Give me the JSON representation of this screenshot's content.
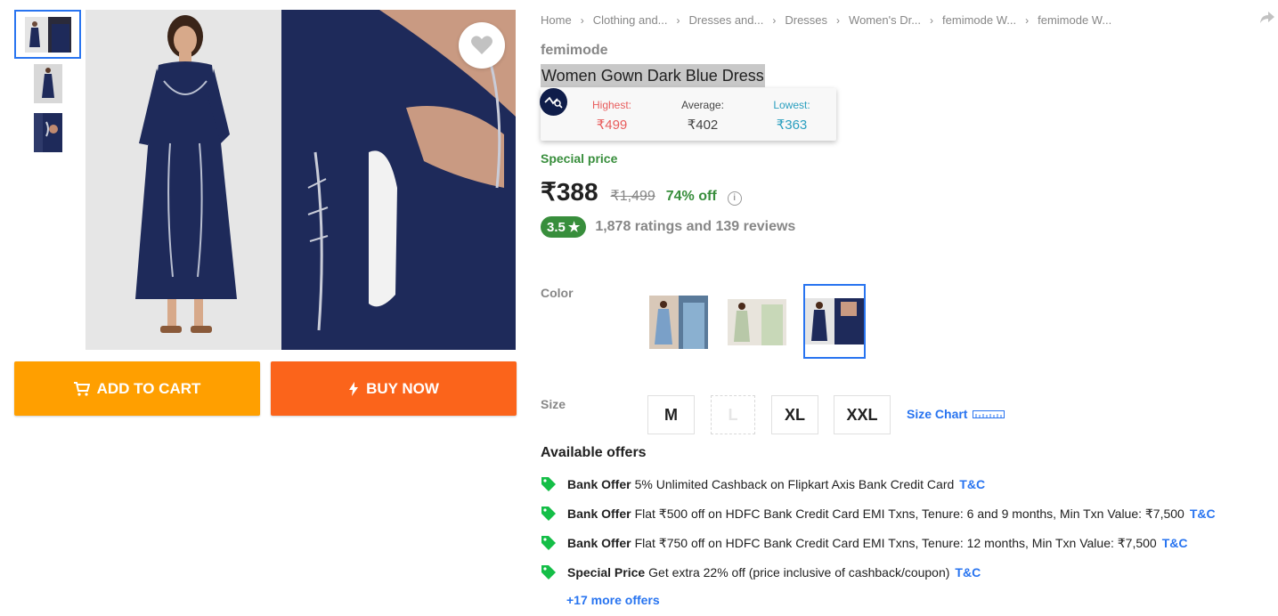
{
  "breadcrumb": [
    "Home",
    "Clothing and...",
    "Dresses and...",
    "Dresses",
    "Women's Dr...",
    "femimode W...",
    "femimode W..."
  ],
  "product": {
    "brand": "femimode",
    "title": "Women Gown Dark Blue Dress"
  },
  "price_history": {
    "highest_label": "Highest:",
    "highest_value": "₹499",
    "average_label": "Average:",
    "average_value": "₹402",
    "lowest_label": "Lowest:",
    "lowest_value": "₹363"
  },
  "pricing": {
    "special_label": "Special price",
    "current": "₹388",
    "mrp": "₹1,499",
    "discount": "74% off",
    "info_glyph": "i"
  },
  "rating": {
    "score": "3.5",
    "star": "★",
    "summary": "1,878 ratings and 139 reviews"
  },
  "color": {
    "label": "Color",
    "selected_index": 2
  },
  "size": {
    "label": "Size",
    "options": [
      "M",
      "L",
      "XL",
      "XXL"
    ],
    "disabled": [
      "L"
    ],
    "chart_label": "Size Chart"
  },
  "actions": {
    "add_to_cart": "ADD TO CART",
    "buy_now": "BUY NOW"
  },
  "offers": {
    "heading": "Available offers",
    "items": [
      {
        "type": "Bank Offer",
        "text": "5% Unlimited Cashback on Flipkart Axis Bank Credit Card",
        "tc": "T&C"
      },
      {
        "type": "Bank Offer",
        "text": "Flat ₹500 off on HDFC Bank Credit Card EMI Txns, Tenure: 6 and 9 months, Min Txn Value: ₹7,500",
        "tc": "T&C"
      },
      {
        "type": "Bank Offer",
        "text": "Flat ₹750 off on HDFC Bank Credit Card EMI Txns, Tenure: 12 months, Min Txn Value: ₹7,500",
        "tc": "T&C"
      },
      {
        "type": "Special Price",
        "text": "Get extra 22% off (price inclusive of cashback/coupon)",
        "tc": "T&C"
      }
    ],
    "more": "+17 more offers"
  },
  "colors": {
    "accent_blue": "#2874f0",
    "green": "#388e3c",
    "cart_orange": "#ff9f00",
    "buy_orange": "#fb641b",
    "dress_navy": "#1e2a5a"
  },
  "icons": [
    "heart-icon",
    "cart-icon",
    "lightning-icon",
    "share-icon",
    "tag-icon",
    "ruler-icon",
    "price-history-logo-icon"
  ]
}
